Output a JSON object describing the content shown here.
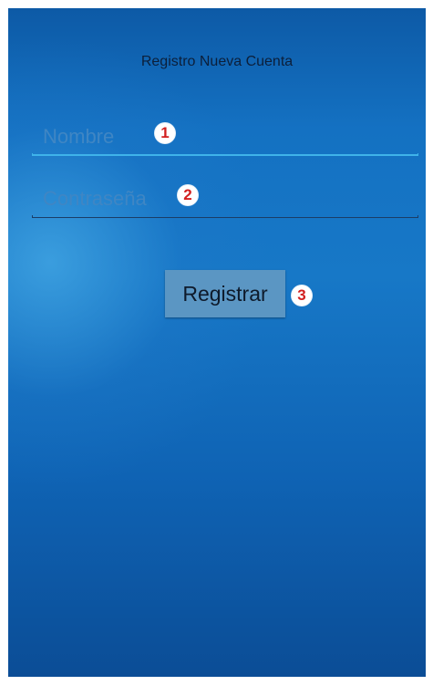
{
  "screen": {
    "title": "Registro Nueva Cuenta"
  },
  "form": {
    "nombre": {
      "placeholder": "Nombre",
      "value": ""
    },
    "contrasena": {
      "placeholder": "Contraseña",
      "value": ""
    },
    "submit_label": "Registrar"
  },
  "annotations": {
    "marker_1": "1",
    "marker_2": "2",
    "marker_3": "3"
  },
  "colors": {
    "background_top": "#0d5aa6",
    "background_bottom": "#0b4d96",
    "focus_underline": "#3fb3ea",
    "button": "#5b96c3",
    "marker_text": "#d21f1f"
  }
}
